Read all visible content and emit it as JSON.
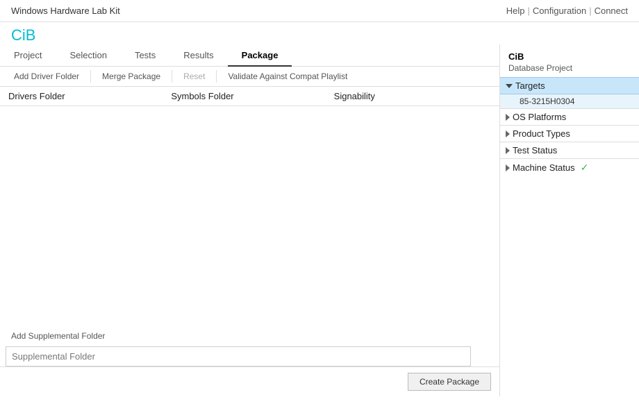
{
  "app": {
    "title": "Windows Hardware Lab Kit",
    "links": [
      "Help",
      "Configuration",
      "Connect"
    ]
  },
  "logo": "CiB",
  "nav": {
    "tabs": [
      "Project",
      "Selection",
      "Tests",
      "Results",
      "Package"
    ],
    "active": "Package"
  },
  "toolbar": {
    "buttons": [
      "Add Driver Folder",
      "Merge Package",
      "Reset",
      "Validate Against Compat Playlist"
    ],
    "disabled": [
      "Reset"
    ]
  },
  "table": {
    "columns": [
      "Drivers Folder",
      "Symbols Folder",
      "Signability"
    ]
  },
  "supplemental": {
    "add_label": "Add Supplemental Folder",
    "box_label": "Supplemental Folder"
  },
  "create_package": "Create Package",
  "right_panel": {
    "title": "CiB",
    "subtitle": "Database Project",
    "targets_label": "Targets",
    "target_value": "85-3215H0304",
    "items": [
      {
        "label": "OS Platforms",
        "expanded": false,
        "check": false
      },
      {
        "label": "Product Types",
        "expanded": false,
        "check": false
      },
      {
        "label": "Test Status",
        "expanded": false,
        "check": false
      },
      {
        "label": "Machine Status",
        "expanded": false,
        "check": true
      }
    ]
  }
}
